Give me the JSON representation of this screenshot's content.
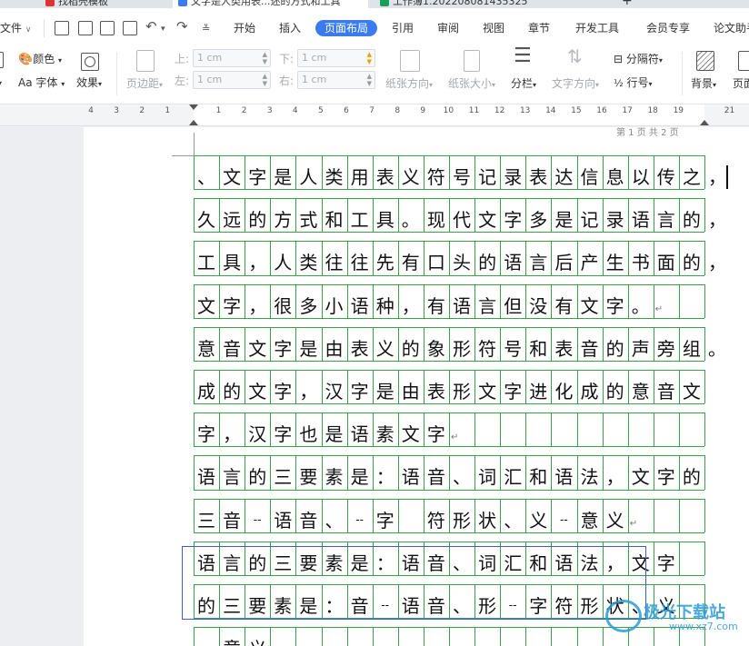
{
  "tabs": [
    {
      "label": "找稻壳模板",
      "color": "#e0322e"
    },
    {
      "label": "文字是人类用表...述的方式和工具",
      "color": "#3a7cf0"
    },
    {
      "label": "工作簿1.202208081435325",
      "color": "#18a058"
    }
  ],
  "menu": {
    "file": "文件",
    "items": [
      "开始",
      "插入",
      "页面布局",
      "引用",
      "审阅",
      "视图",
      "章节",
      "开发工具",
      "会员专享",
      "论文助手"
    ],
    "active_index": 2
  },
  "ribbon": {
    "color_label": "颜色",
    "font_label": "Aa 字体",
    "effect_label": "效果",
    "margin_label": "页边距",
    "top_label": "上:",
    "top_value": "1 cm",
    "bottom_label": "下:",
    "bottom_value": "1 cm",
    "left_label": "左:",
    "left_value": "1 cm",
    "right_label": "右:",
    "right_value": "1 cm",
    "orientation_label": "纸张方向",
    "size_label": "纸张大小",
    "columns_label": "分栏",
    "text_direction_label": "文字方向",
    "separator_label": "分隔符",
    "line_number_label": "行号",
    "background_label": "背景",
    "page_border_label": "页面"
  },
  "ruler": {
    "numbers": [
      "4",
      "3",
      "2",
      "1",
      "",
      "1",
      "2",
      "3",
      "4",
      "5",
      "6",
      "7",
      "8",
      "9",
      "10",
      "11",
      "12",
      "13",
      "14",
      "15",
      "16",
      "17",
      "18",
      "19",
      "",
      "21"
    ]
  },
  "document": {
    "header": "第 1 页 共 2 页",
    "lines": [
      "、文字是人类用表义符号记录表达信息以传之，",
      "久远的方式和工具。现代文字多是记录语言的，",
      "工具，人类往往先有口头的语言后产生书面的，",
      "文字，很多小语种，有语言但没有文字。",
      "意音文字是由表义的象形符号和表音的声旁组。",
      "成的文字，汉字是由表形文字进化成的意音文",
      "字，汉字也是语素文字",
      "语言的三要素是：语音、词汇和语法，文字的",
      "三音--语音、--字 符形状、义--意义",
      "语言的三要素是：语音、词汇和语法，文字",
      "的三要素是：音--语音、形--字符形状、义",
      "--意义"
    ]
  },
  "watermark": {
    "title": "极光下载站",
    "url": "www.xz7.com"
  },
  "colors": {
    "accent": "#3a7cf0",
    "grid": "#3aa04a",
    "selection": "#3f5ec9"
  }
}
